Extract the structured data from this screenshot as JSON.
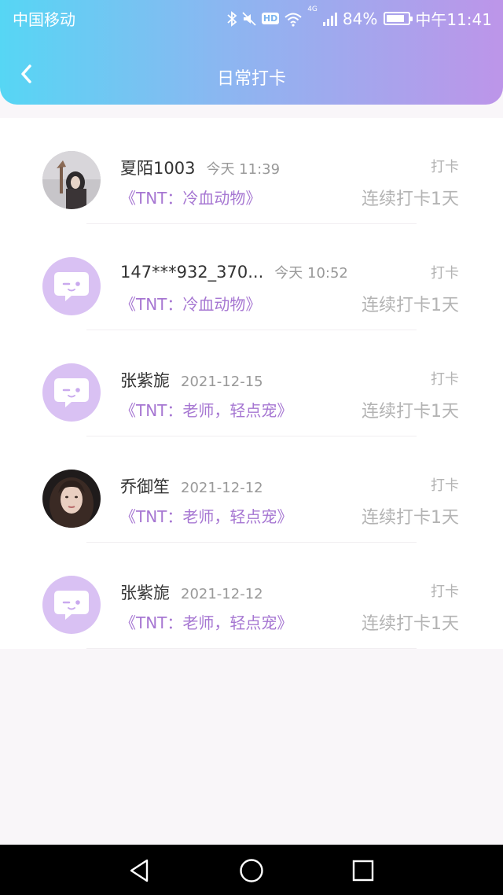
{
  "status_bar": {
    "carrier": "中国移动",
    "network": "4G",
    "hd": "HD",
    "battery_percent": "84%",
    "battery_level": 0.84,
    "time": "中午11:41"
  },
  "header": {
    "title": "日常打卡",
    "gradient": [
      "#56d6f4",
      "#bd95e9"
    ]
  },
  "records": [
    {
      "name": "夏陌1003",
      "time": "今天 11:39",
      "book": "《TNT：冷血动物》",
      "tag": "打卡",
      "streak": "连续打卡1天",
      "avatar": "photo-girl-sky"
    },
    {
      "name": "147***932_370...",
      "time": "今天 10:52",
      "book": "《TNT：冷血动物》",
      "tag": "打卡",
      "streak": "连续打卡1天",
      "avatar": "default-chat-bubble"
    },
    {
      "name": "张紫旎",
      "time": "2021-12-15",
      "book": "《TNT：老师，轻点宠》",
      "tag": "打卡",
      "streak": "连续打卡1天",
      "avatar": "default-chat-bubble"
    },
    {
      "name": "乔御笙",
      "time": "2021-12-12",
      "book": "《TNT：老师，轻点宠》",
      "tag": "打卡",
      "streak": "连续打卡1天",
      "avatar": "photo-girl-portrait"
    },
    {
      "name": "张紫旎",
      "time": "2021-12-12",
      "book": "《TNT：老师，轻点宠》",
      "tag": "打卡",
      "streak": "连续打卡1天",
      "avatar": "default-chat-bubble"
    }
  ],
  "colors": {
    "accent_purple": "#a676d2",
    "avatar_default_bg": "#d9c1f3",
    "muted_text": "#b3b3b3"
  },
  "system_nav": {
    "back": "back-triangle-icon",
    "home": "home-circle-icon",
    "recents": "recents-square-icon"
  }
}
